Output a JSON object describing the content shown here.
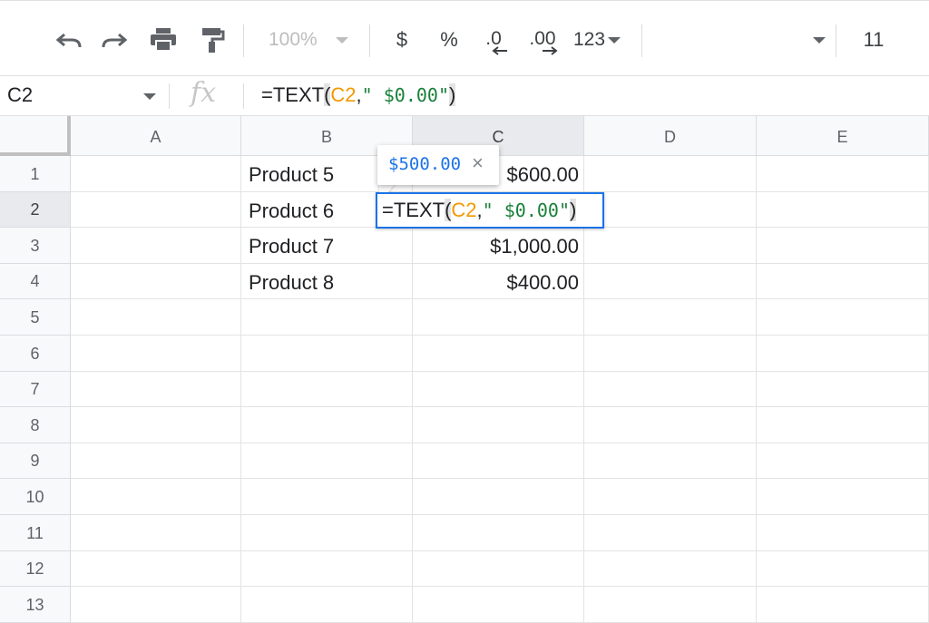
{
  "toolbar": {
    "zoom": "100%",
    "currency": "$",
    "percent": "%",
    "decrease_decimal": ".0",
    "increase_decimal": ".00",
    "more_formats": "123",
    "font_size": "11",
    "icons": [
      "undo-icon",
      "redo-icon",
      "print-icon",
      "paint-format-icon"
    ]
  },
  "formula_bar": {
    "name_box": "C2",
    "fx": "fx",
    "formula": {
      "prefix": "=TEXT",
      "open_paren": "(",
      "ref": "C2",
      "comma": ",",
      "string": "\" $0.00\"",
      "close_paren": ")"
    }
  },
  "grid": {
    "columns": [
      "A",
      "B",
      "C",
      "D",
      "E"
    ],
    "selected_column": "C",
    "rows": [
      "1",
      "2",
      "3",
      "4",
      "5",
      "6",
      "7",
      "8",
      "9",
      "10",
      "11",
      "12",
      "13"
    ],
    "selected_row": "2",
    "cells": {
      "B1": "Product 5",
      "C1": "$600.00",
      "B2": "Product 6",
      "B3": "Product 7",
      "C3": "$1,000.00",
      "B4": "Product 8",
      "C4": "$400.00"
    }
  },
  "editor": {
    "preview_value": "$500.00",
    "preview_close": "×"
  },
  "colors": {
    "accent": "#1a73e8",
    "reference": "#f29900",
    "string": "#188038"
  }
}
